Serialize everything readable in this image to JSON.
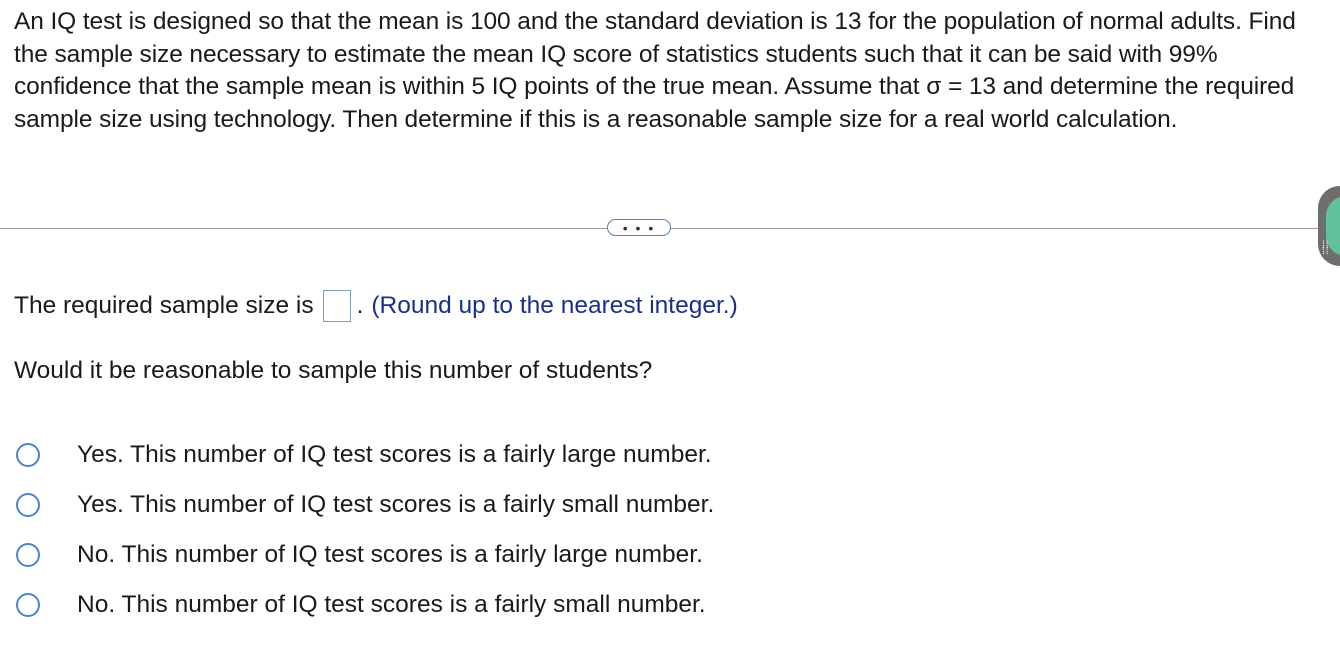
{
  "question": {
    "text": "An IQ test is designed so that the mean is 100 and the standard deviation is 13 for the population of normal adults. Find the sample size necessary to estimate the mean IQ score of statistics students such that it can be said with 99% confidence that the sample mean is within 5 IQ points of the true mean. Assume that σ = 13 and determine the required sample size using technology. Then determine if this is a reasonable sample size for a real world calculation."
  },
  "more_button": {
    "label": "• • •"
  },
  "answer": {
    "prefix": "The required sample size is",
    "value": "",
    "period": ".",
    "hint": "(Round up to the nearest integer.)"
  },
  "sub_question": {
    "text": "Would it be reasonable to sample this number of students?"
  },
  "options": [
    {
      "label": "Yes. This number of IQ test scores is a fairly large number.",
      "selected": false
    },
    {
      "label": "Yes. This number of IQ test scores is a fairly small number.",
      "selected": false
    },
    {
      "label": "No. This number of IQ test scores is a fairly large number.",
      "selected": false
    },
    {
      "label": "No. This number of IQ test scores is a fairly small number.",
      "selected": false
    }
  ],
  "colors": {
    "accent": "#4a84d4",
    "hint_text": "#1a2f8a",
    "side_handle": "#62c19a"
  },
  "icons": {
    "side_handle": "grid-dots-icon",
    "radio": "radio-unchecked-icon"
  }
}
